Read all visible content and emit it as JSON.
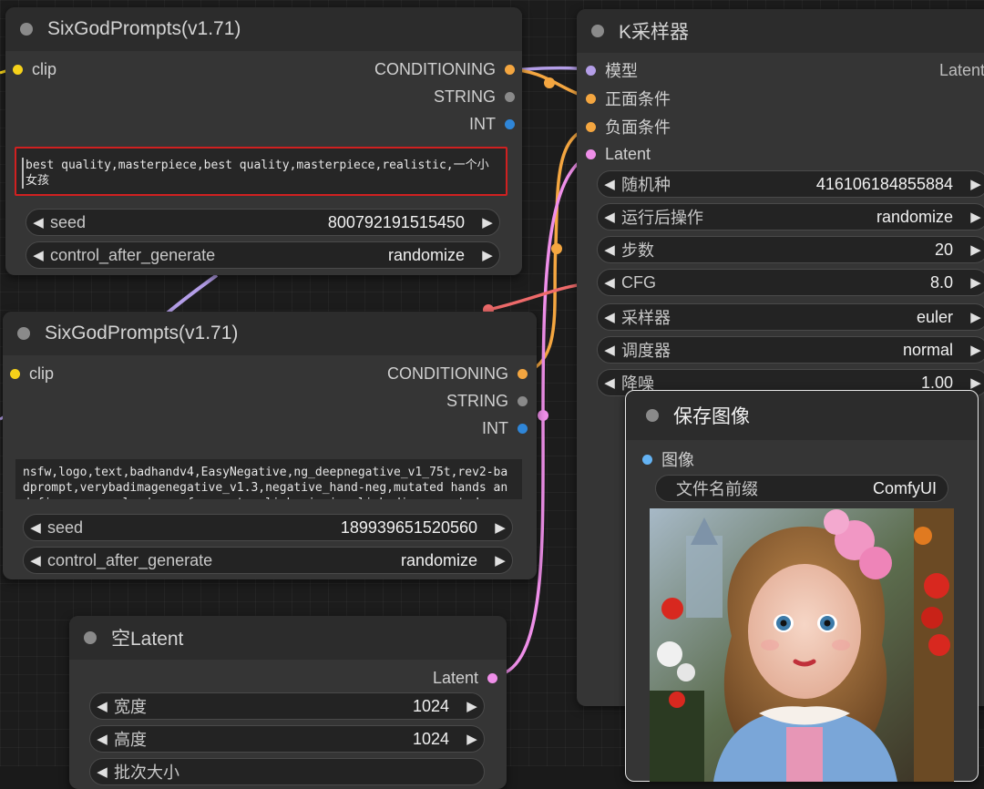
{
  "nodes": {
    "prompt_pos": {
      "title": "SixGodPrompts(v1.71)",
      "input_clip": "clip",
      "outputs": [
        "CONDITIONING",
        "STRING",
        "INT"
      ],
      "prompt_text": "best quality,masterpiece,best quality,masterpiece,realistic,一个小女孩",
      "seed_label": "seed",
      "seed_value": "800792191515450",
      "control_label": "control_after_generate",
      "control_value": "randomize"
    },
    "prompt_neg": {
      "title": "SixGodPrompts(v1.71)",
      "input_clip": "clip",
      "outputs": [
        "CONDITIONING",
        "STRING",
        "INT"
      ],
      "prompt_text": "nsfw,logo,text,badhandv4,EasyNegative,ng_deepnegative_v1_75t,rev2-badprompt,verybadimagenegative_v1.3,negative_hand-neg,mutated hands and fingers,poorly drawn face,extra limb,missing limb,disconnected",
      "seed_label": "seed",
      "seed_value": "189939651520560",
      "control_label": "control_after_generate",
      "control_value": "randomize"
    },
    "empty_latent": {
      "title": "空Latent",
      "output": "Latent",
      "width_label": "宽度",
      "width_value": "1024",
      "height_label": "高度",
      "height_value": "1024",
      "batch_label": "批次大小"
    },
    "ksampler": {
      "title": "K采样器",
      "inputs": [
        "模型",
        "正面条件",
        "负面条件",
        "Latent"
      ],
      "output": "Latent",
      "widgets": [
        {
          "label": "随机种",
          "value": "416106184855884"
        },
        {
          "label": "运行后操作",
          "value": "randomize"
        },
        {
          "label": "步数",
          "value": "20"
        },
        {
          "label": "CFG",
          "value": "8.0"
        },
        {
          "label": "采样器",
          "value": "euler"
        },
        {
          "label": "调度器",
          "value": "normal"
        },
        {
          "label": "降噪",
          "value": "1.00"
        }
      ]
    },
    "save_image": {
      "title": "保存图像",
      "input_image": "图像",
      "prefix_label": "文件名前缀",
      "prefix_value": "ComfyUI"
    }
  },
  "colors": {
    "clip": "#f6d21a",
    "conditioning": "#f4a640",
    "string": "#8a8a8a",
    "int": "#2f86d8",
    "model": "#b49ee8",
    "latent": "#ef8fe9",
    "image": "#64b3f4",
    "vae": "#ee6a6a",
    "highlight_border": "#d02020"
  },
  "arrows": {
    "left": "◀",
    "right": "▶"
  }
}
